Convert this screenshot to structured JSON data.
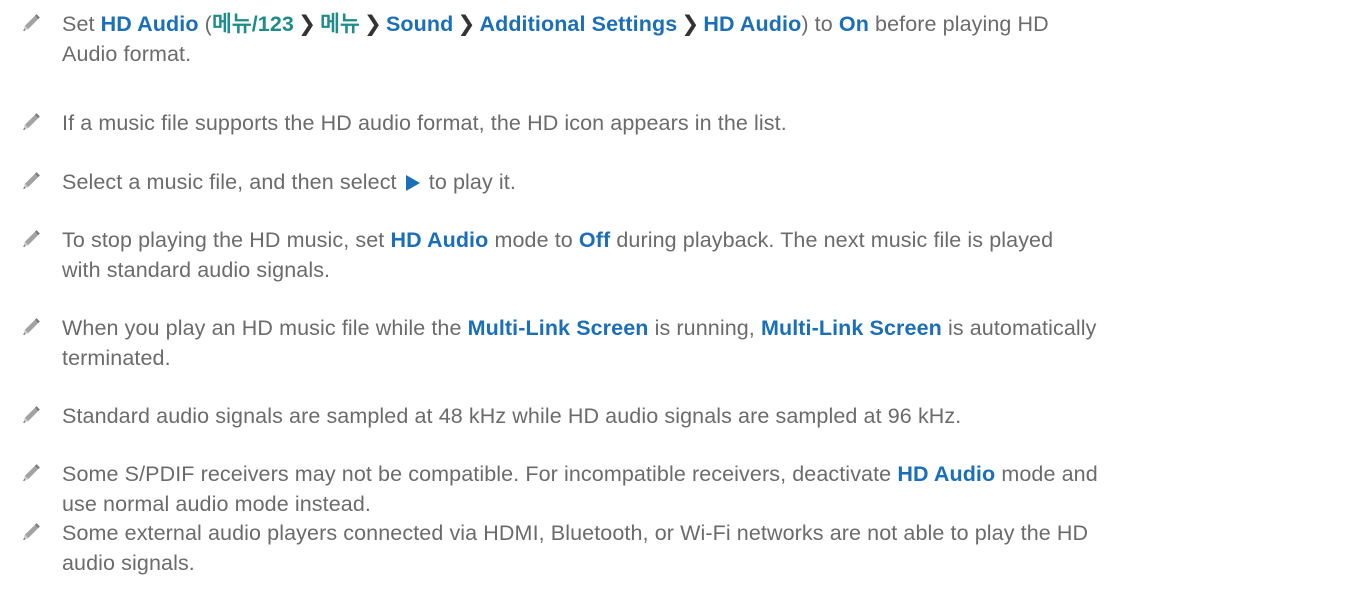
{
  "colors": {
    "body_text": "#6b6b6b",
    "highlight": "#1a6fb8",
    "menu_path": "#1e8c8a",
    "icon": "#8a8a8a"
  },
  "icons": {
    "note": "pencil-icon",
    "play": "play-icon",
    "separator": "chevron-right-icon"
  },
  "notes": [
    {
      "t1": "Set ",
      "b1": "HD Audio",
      "t2": " (",
      "path": [
        "메뉴/123",
        "메뉴",
        "Sound",
        "Additional Settings",
        "HD Audio"
      ],
      "t3": ") to ",
      "b2": "On",
      "t4": " before playing HD",
      "t5": "Audio format."
    },
    {
      "t1": "If a music file supports the HD audio format, the HD icon appears in the list."
    },
    {
      "t1": "Select a music file, and then select ",
      "t2": " to play it."
    },
    {
      "t1": "To stop playing the HD music, set ",
      "b1": "HD Audio",
      "t2": " mode to ",
      "b2": "Off",
      "t3": " during playback. The next music file is played",
      "t4": "with standard audio signals."
    },
    {
      "t1": "When you play an HD music file while the ",
      "b1": "Multi-Link Screen",
      "t2": " is running, ",
      "b2": "Multi-Link Screen",
      "t3": " is automatically",
      "t4": "terminated."
    },
    {
      "t1": "Standard audio signals are sampled at 48 kHz while HD audio signals are sampled at 96 kHz."
    },
    {
      "t1": "Some S/PDIF receivers may not be compatible. For incompatible receivers, deactivate ",
      "b1": "HD Audio",
      "t2": " mode and",
      "t3": "use normal audio mode instead."
    },
    {
      "t1": "Some external audio players connected via HDMI, Bluetooth, or Wi-Fi networks are not able to play the HD",
      "t2": "audio signals."
    }
  ]
}
